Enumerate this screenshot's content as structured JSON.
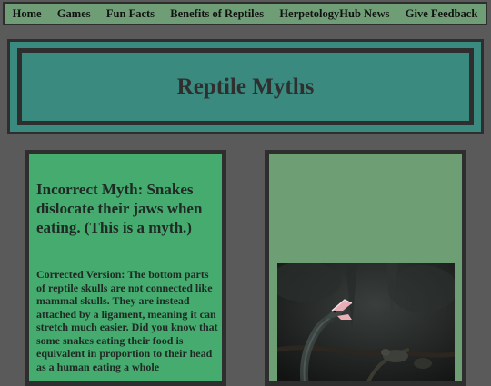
{
  "nav": {
    "items": [
      "Home",
      "Games",
      "Fun Facts",
      "Benefits of Reptiles",
      "HerpetologyHub News",
      "Give Feedback"
    ]
  },
  "hero": {
    "title": "Reptile Myths"
  },
  "myth_card": {
    "title": "Incorrect Myth: Snakes dislocate their jaws when eating. (This is a myth.)",
    "body": "Corrected Version: The bottom parts of reptile skulls are not connected like mammal skulls. They are instead attached by a ligament, meaning it can stretch much easier. Did you know that some snakes eating their food is equivalent in proportion to their head as a human eating a whole"
  },
  "photo_card": {
    "image": "snake-open-mouth-photo"
  },
  "colors": {
    "background": "#5a5a5a",
    "nav": "#6f9e76",
    "hero": "#3b8a7f",
    "myth_card": "#45ab6f",
    "photo_card": "#6e9e74",
    "border": "#2e2e2e"
  }
}
